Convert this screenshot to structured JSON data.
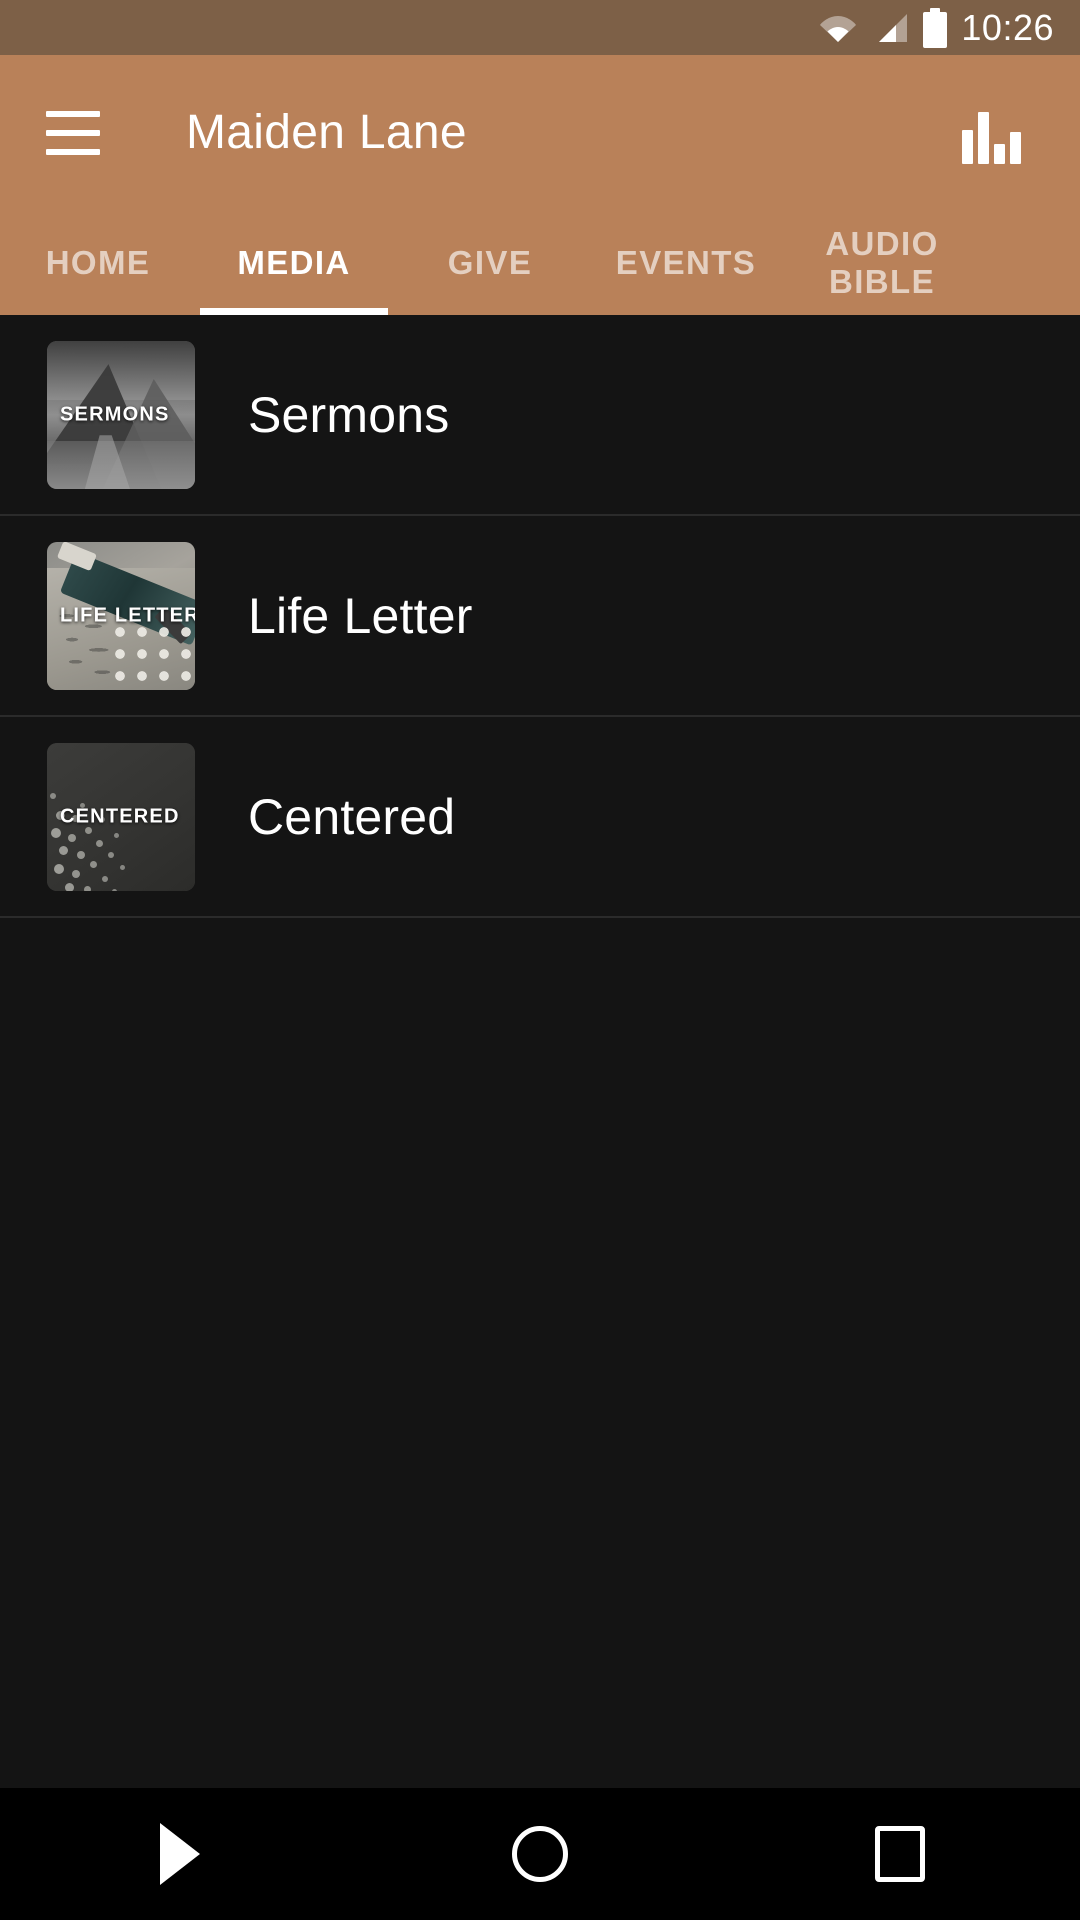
{
  "status_bar": {
    "time": "10:26",
    "icons": [
      "wifi-icon",
      "cellular-signal-icon",
      "battery-icon"
    ],
    "background_color": "#7d6047"
  },
  "app_bar": {
    "title": "Maiden Lane",
    "menu_icon": "hamburger-menu-icon",
    "action_icon": "bar-chart-icon",
    "background_color": "#b98159",
    "text_color": "#ffffff"
  },
  "tabs": {
    "active_index": 1,
    "items": [
      {
        "label": "HOME",
        "active": false
      },
      {
        "label": "MEDIA",
        "active": true
      },
      {
        "label": "GIVE",
        "active": false
      },
      {
        "label": "EVENTS",
        "active": false
      },
      {
        "label": "AUDIO\nBIBLE",
        "active": false
      }
    ],
    "indicator_color": "#ffffff",
    "inactive_color": "rgba(255,255,255,0.62)"
  },
  "media_list": {
    "background_color": "#141414",
    "divider_color": "#2b2b2b",
    "items": [
      {
        "title": "Sermons",
        "thumbnail_label": "SERMONS",
        "thumbnail_art": "grayscale-mountain-valley-photo"
      },
      {
        "title": "Life Letter",
        "thumbnail_label": "LIFE LETTER",
        "thumbnail_art": "fountain-pen-on-handwritten-paper-photo"
      },
      {
        "title": "Centered",
        "thumbnail_label": "CENTERED",
        "thumbnail_art": "dark-gray-dot-spray-graphic"
      }
    ]
  },
  "nav_bar": {
    "background_color": "#000000",
    "buttons": [
      {
        "name": "back-button",
        "icon": "back-triangle-icon"
      },
      {
        "name": "home-button",
        "icon": "home-circle-icon"
      },
      {
        "name": "recents-button",
        "icon": "recents-square-icon"
      }
    ]
  }
}
